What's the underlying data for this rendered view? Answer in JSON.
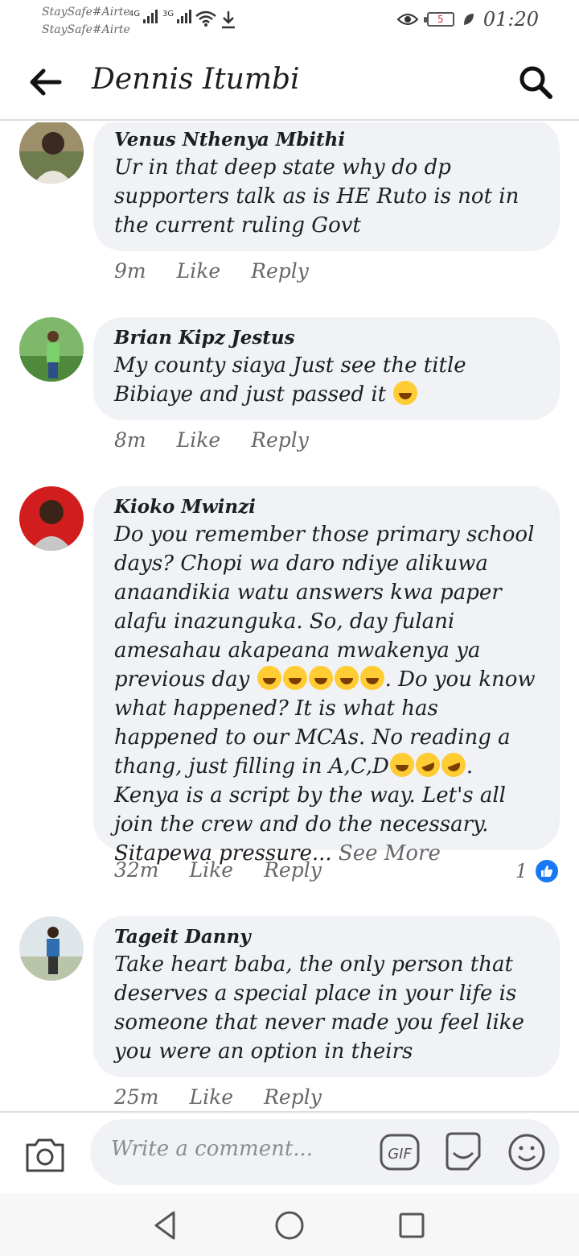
{
  "status_bar": {
    "carrier_line_1": "StaySafe#Airte",
    "carrier_line_2": "StaySafe#Airte",
    "network_1": "4G",
    "network_2": "3G",
    "battery_level": "5",
    "time": "01:20"
  },
  "header": {
    "title": "Dennis Itumbi"
  },
  "comments": [
    {
      "author": "Venus Nthenya Mbithi",
      "text": "Ur in that deep state why do dp supporters talk as is HE Ruto is not in the current ruling Govt",
      "time": "9m",
      "like_label": "Like",
      "reply_label": "Reply"
    },
    {
      "author": "Brian Kipz Jestus",
      "text": "My county siaya Just see the title Bibiaye and just passed it",
      "time": "8m",
      "like_label": "Like",
      "reply_label": "Reply"
    },
    {
      "author": "Kioko Mwinzi",
      "text_1": "Do you remember those primary school days? Chopi wa daro ndiye alikuwa anaandikia watu answers kwa paper alafu inazunguka. So, day fulani amesahau akapeana mwakenya ya previous day",
      "text_2": ". Do you know what happened? It is what has happened to our MCAs. No reading a thang, just filling in A,C,D",
      "text_3": ". Kenya is a script by the way. Let's all join the crew and do the necessary. Sitapewa pressure...",
      "see_more": "See More",
      "time": "32m",
      "like_label": "Like",
      "reply_label": "Reply",
      "reaction_count": "1"
    },
    {
      "author": "Tageit Danny",
      "text": "Take heart baba, the only person that deserves a special place in your life is someone that never made you feel like you were an option in theirs",
      "time": "25m",
      "like_label": "Like",
      "reply_label": "Reply"
    }
  ],
  "composer": {
    "placeholder": "Write a comment...",
    "gif_label": "GIF"
  },
  "icons": {
    "back": "arrow-left-icon",
    "search": "search-icon",
    "camera": "camera-icon",
    "sticker": "sticker-icon",
    "emoji": "smiley-icon",
    "like": "thumbs-up-icon"
  },
  "colors": {
    "bubble": "#f0f2f5",
    "meta_text": "#65676b",
    "like_blue": "#1877f2"
  }
}
